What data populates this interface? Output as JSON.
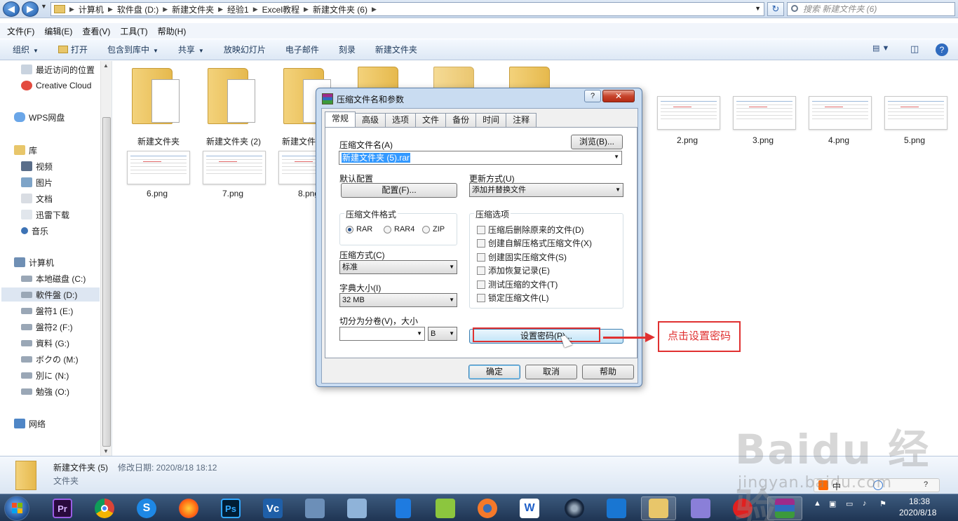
{
  "address": {
    "crumbs": [
      "计算机",
      "软件盘 (D:)",
      "新建文件夹",
      "经验1",
      "Excel教程",
      "新建文件夹 (6)"
    ],
    "search_placeholder": "搜索 新建文件夹 (6)"
  },
  "menubar": [
    "文件(F)",
    "编辑(E)",
    "查看(V)",
    "工具(T)",
    "帮助(H)"
  ],
  "toolbar": {
    "organize": "组织",
    "open": "打开",
    "include": "包含到库中",
    "share": "共享",
    "slideshow": "放映幻灯片",
    "email": "电子邮件",
    "burn": "刻录",
    "new_folder": "新建文件夹"
  },
  "sidebar": {
    "recent": "最近访问的位置",
    "creative_cloud": "Creative Cloud",
    "wps": "WPS网盘",
    "library": "库",
    "video": "视频",
    "pictures": "图片",
    "documents": "文档",
    "thunder": "迅雷下载",
    "music": "音乐",
    "computer": "计算机",
    "drives": [
      "本地磁盘 (C:)",
      "軟件盤 (D:)",
      "盤符1 (E:)",
      "盤符2 (F:)",
      "資料 (G:)",
      "ボクの (M:)",
      "別に (N:)",
      "勉強 (O:)"
    ],
    "network": "网络"
  },
  "files": {
    "folders": [
      "新建文件夹",
      "新建文件夹 (2)",
      "新建文件夹"
    ],
    "pngs_top": [
      "2.png",
      "3.png",
      "4.png",
      "5.png"
    ],
    "pngs_bottom": [
      "6.png",
      "7.png",
      "8.png"
    ]
  },
  "details": {
    "name": "新建文件夹 (5)",
    "modified": "修改日期: 2020/8/18 18:12",
    "type": "文件夹"
  },
  "dialog": {
    "title": "压缩文件名和参数",
    "tabs": [
      "常规",
      "高级",
      "选项",
      "文件",
      "备份",
      "时间",
      "注释"
    ],
    "archive_name_label": "压缩文件名(A)",
    "browse": "浏览(B)...",
    "archive_name": "新建文件夹 (5).rar",
    "default_profile_label": "默认配置",
    "profiles_button": "配置(F)...",
    "update_mode_label": "更新方式(U)",
    "update_mode": "添加并替换文件",
    "format_label": "压缩文件格式",
    "formats": [
      "RAR",
      "RAR4",
      "ZIP"
    ],
    "selected_format": "RAR",
    "method_label": "压缩方式(C)",
    "method": "标准",
    "dict_label": "字典大小(I)",
    "dict": "32 MB",
    "split_label": "切分为分卷(V)，大小",
    "split_unit": "B",
    "options_label": "压缩选项",
    "options": [
      "压缩后删除原来的文件(D)",
      "创建自解压格式压缩文件(X)",
      "创建固实压缩文件(S)",
      "添加恢复记录(E)",
      "测试压缩的文件(T)",
      "锁定压缩文件(L)"
    ],
    "set_password": "设置密码(P)...",
    "ok": "确定",
    "cancel": "取消",
    "help": "帮助"
  },
  "annotation": "点击设置密码",
  "taskbar": {
    "ime": "中",
    "time": "18:38",
    "date": "2020/8/18"
  },
  "watermark": {
    "brand": "Baidu 经验",
    "url": "jingyan.baidu.com"
  }
}
